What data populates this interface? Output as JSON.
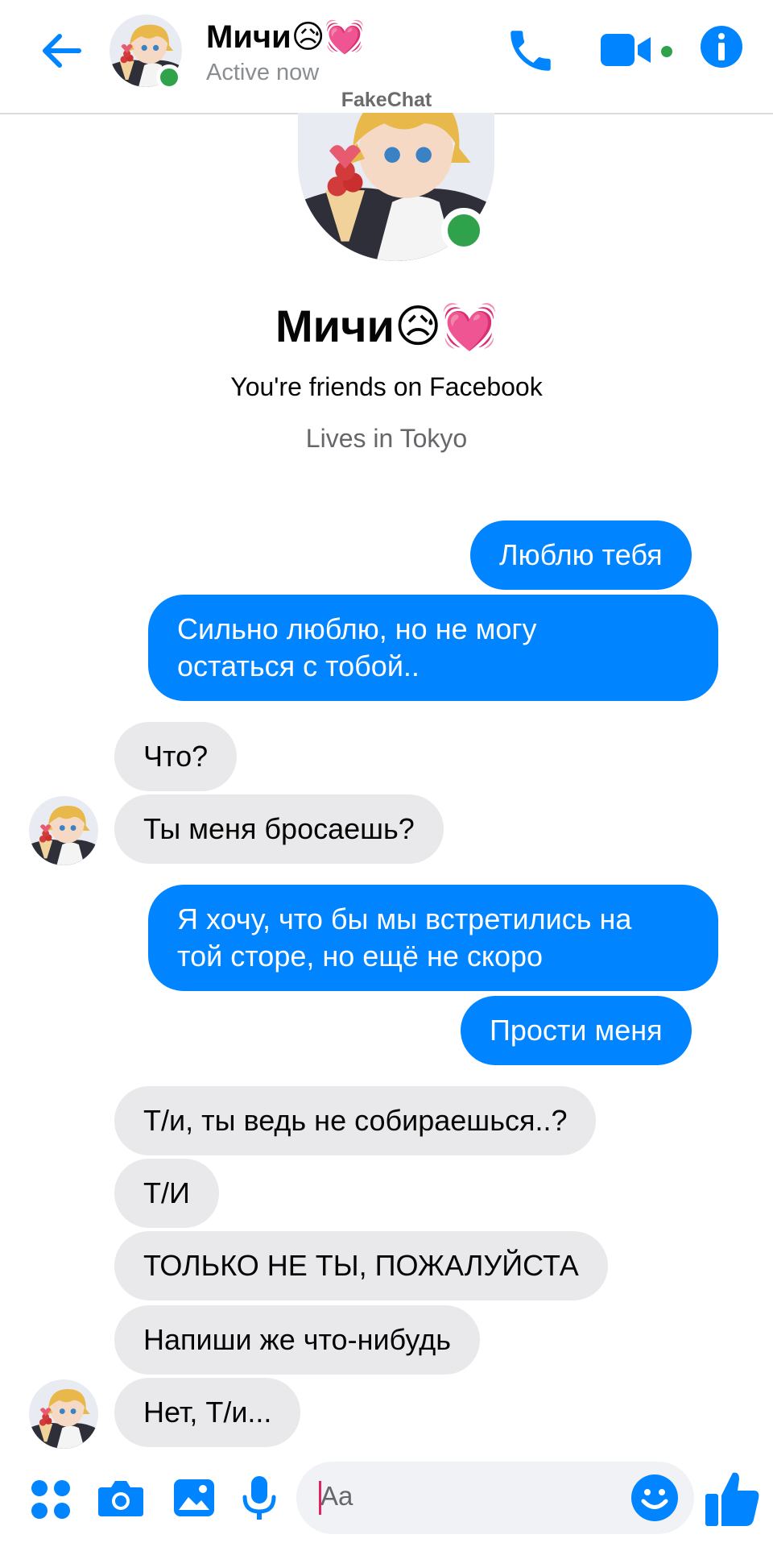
{
  "header": {
    "name": "Мичи😥💓",
    "status": "Active now"
  },
  "watermark": "FakeChat",
  "profile": {
    "name": "Мичи😥💓",
    "friends_text": "You're friends on Facebook",
    "lives_text": "Lives in Tokyo"
  },
  "messages": [
    {
      "dir": "out",
      "lines": [
        "Люблю тебя"
      ]
    },
    {
      "dir": "out",
      "lines": [
        "Сильно люблю, но не могу",
        "остаться с тобой.."
      ]
    },
    {
      "dir": "in",
      "lines": [
        "Что?"
      ]
    },
    {
      "dir": "in",
      "lines": [
        "Ты меня бросаешь?"
      ]
    },
    {
      "dir": "out",
      "lines": [
        "Я хочу, что бы мы встретились на",
        "той сторе, но ещё не скоро"
      ]
    },
    {
      "dir": "out",
      "lines": [
        "Прости меня"
      ]
    },
    {
      "dir": "in",
      "lines": [
        "Т/и, ты ведь не собираешься..?"
      ]
    },
    {
      "dir": "in",
      "lines": [
        "Т/И"
      ]
    },
    {
      "dir": "in",
      "lines": [
        "ТОЛЬКО НЕ ТЫ, ПОЖАЛУЙСТА"
      ]
    },
    {
      "dir": "in",
      "lines": [
        "Напиши же что-нибудь"
      ]
    },
    {
      "dir": "in",
      "lines": [
        "Нет, Т/и..."
      ]
    }
  ],
  "composer": {
    "placeholder": "Aa"
  },
  "icons": {
    "back": "back-arrow-icon",
    "call": "phone-icon",
    "video": "video-camera-icon",
    "info": "info-icon",
    "apps": "apps-grid-icon",
    "camera": "camera-icon",
    "gallery": "image-icon",
    "mic": "microphone-icon",
    "emoji": "emoji-icon",
    "like": "thumbs-up-icon"
  },
  "colors": {
    "accent": "#0084ff",
    "incoming_bubble": "#e9e9eb",
    "online": "#31a24c"
  }
}
